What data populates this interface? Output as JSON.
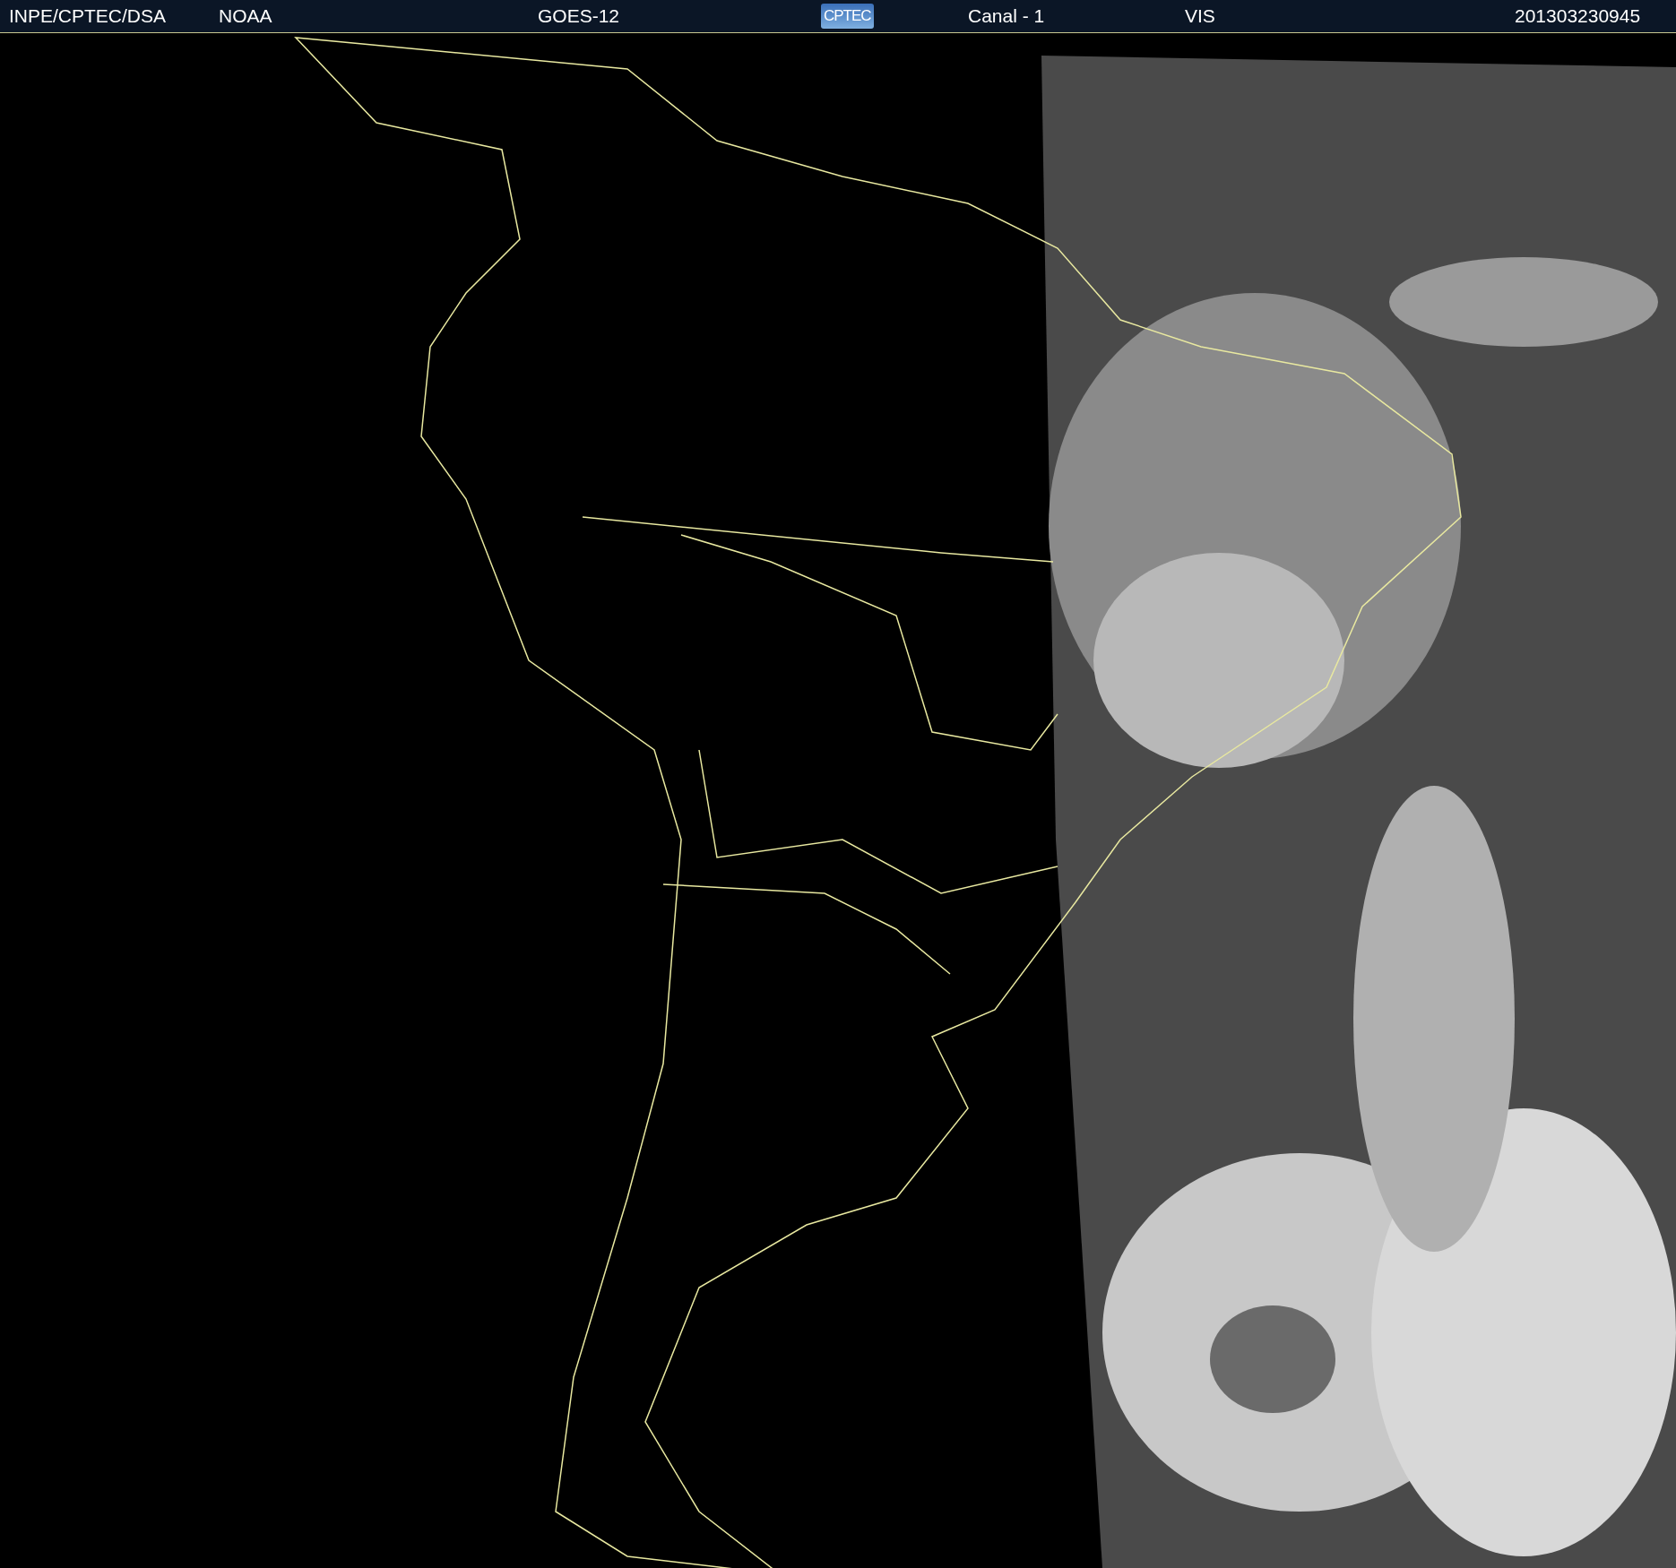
{
  "header": {
    "source": "INPE/CPTEC/DSA",
    "agency": "NOAA",
    "satellite": "GOES-12",
    "logo": "CPTEC",
    "channel": "Canal - 1",
    "band": "VIS",
    "timestamp": "201303230945"
  }
}
